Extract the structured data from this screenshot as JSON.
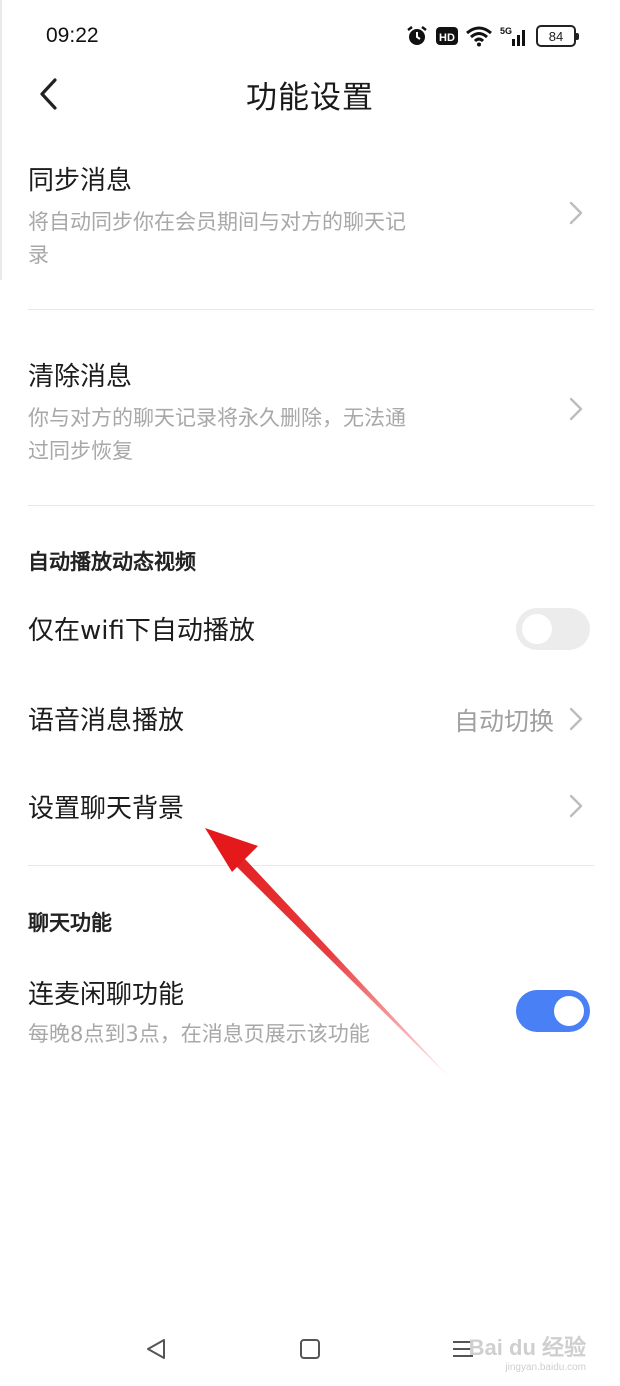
{
  "status_bar": {
    "time": "09:22",
    "battery": "84",
    "network": "5G",
    "hd_label": "HD",
    "icons": [
      "alarm-icon",
      "hd-icon",
      "wifi-icon",
      "signal-icon",
      "battery-icon"
    ]
  },
  "header": {
    "title": "功能设置",
    "back_icon": "chevron-left-icon"
  },
  "rows": {
    "sync": {
      "title": "同步消息",
      "desc": "将自动同步你在会员期间与对方的聊天记录"
    },
    "clear": {
      "title": "清除消息",
      "desc": "你与对方的聊天记录将永久删除，无法通过同步恢复"
    }
  },
  "sections": {
    "autoplay": "自动播放动态视频",
    "chat": "聊天功能"
  },
  "autoplay_rows": {
    "wifi_only": {
      "title": "仅在wifi下自动播放",
      "toggle_on": false
    },
    "voice_play": {
      "title": "语音消息播放",
      "value": "自动切换"
    },
    "chat_background": {
      "title": "设置聊天背景"
    }
  },
  "chat_rows": {
    "voice_chat": {
      "title": "连麦闲聊功能",
      "desc": "每晚8点到3点，在消息页展示该功能",
      "toggle_on": true
    }
  },
  "colors": {
    "accent": "#4a80f6",
    "arrow": "#e3191c",
    "secondary_text": "#a8a8a8"
  },
  "nav_bar": {
    "icons": [
      "back-triangle-icon",
      "home-square-icon",
      "menu-lines-icon"
    ]
  },
  "watermark": {
    "logo": "Bai du 经验",
    "url": "jingyan.baidu.com"
  }
}
